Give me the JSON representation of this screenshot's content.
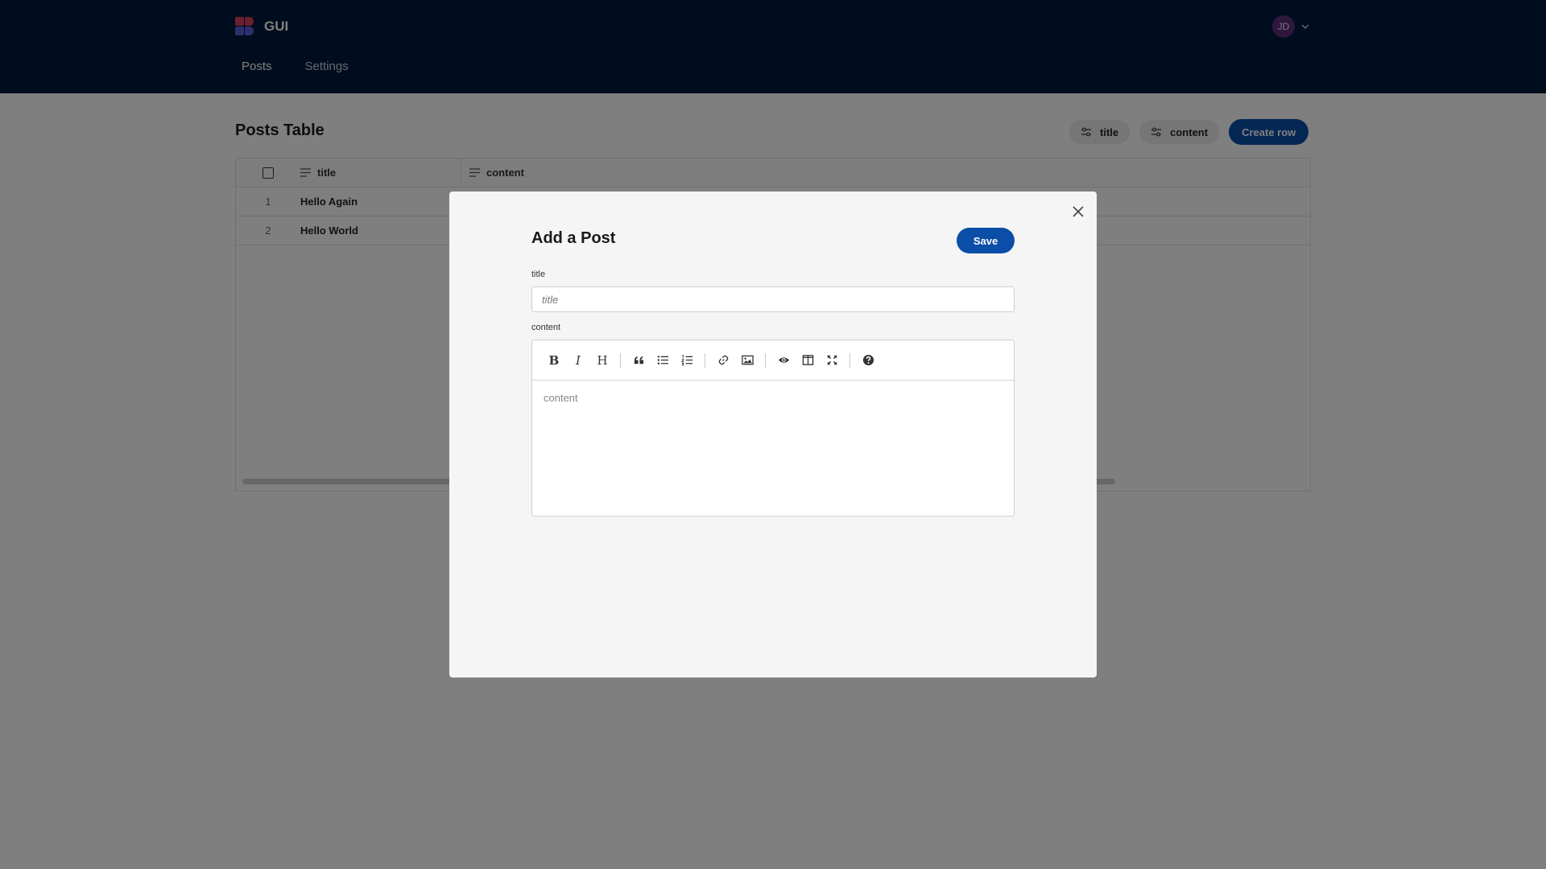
{
  "header": {
    "app_name": "GUI",
    "user_initials": "JD",
    "nav": [
      {
        "label": "Posts",
        "active": true
      },
      {
        "label": "Settings",
        "active": false
      }
    ]
  },
  "page": {
    "title": "Posts Table",
    "filters": [
      {
        "label": "title",
        "icon": "sliders-icon"
      },
      {
        "label": "content",
        "icon": "sliders-icon"
      }
    ],
    "create_label": "Create row"
  },
  "table": {
    "columns": [
      "title",
      "content"
    ],
    "rows": [
      {
        "num": "1",
        "title": "Hello Again"
      },
      {
        "num": "2",
        "title": "Hello World"
      }
    ]
  },
  "modal": {
    "title": "Add a Post",
    "save_label": "Save",
    "title_label": "title",
    "title_placeholder": "title",
    "content_label": "content",
    "content_placeholder": "content",
    "toolbar": [
      "bold-icon",
      "italic-icon",
      "heading-icon",
      "quote-icon",
      "unordered-list-icon",
      "ordered-list-icon",
      "link-icon",
      "image-icon",
      "preview-icon",
      "side-by-side-icon",
      "fullscreen-icon",
      "help-icon"
    ]
  },
  "colors": {
    "header_bg": "#001b3d",
    "primary": "#0a4ea8",
    "avatar_bg": "#5c2d7a"
  }
}
